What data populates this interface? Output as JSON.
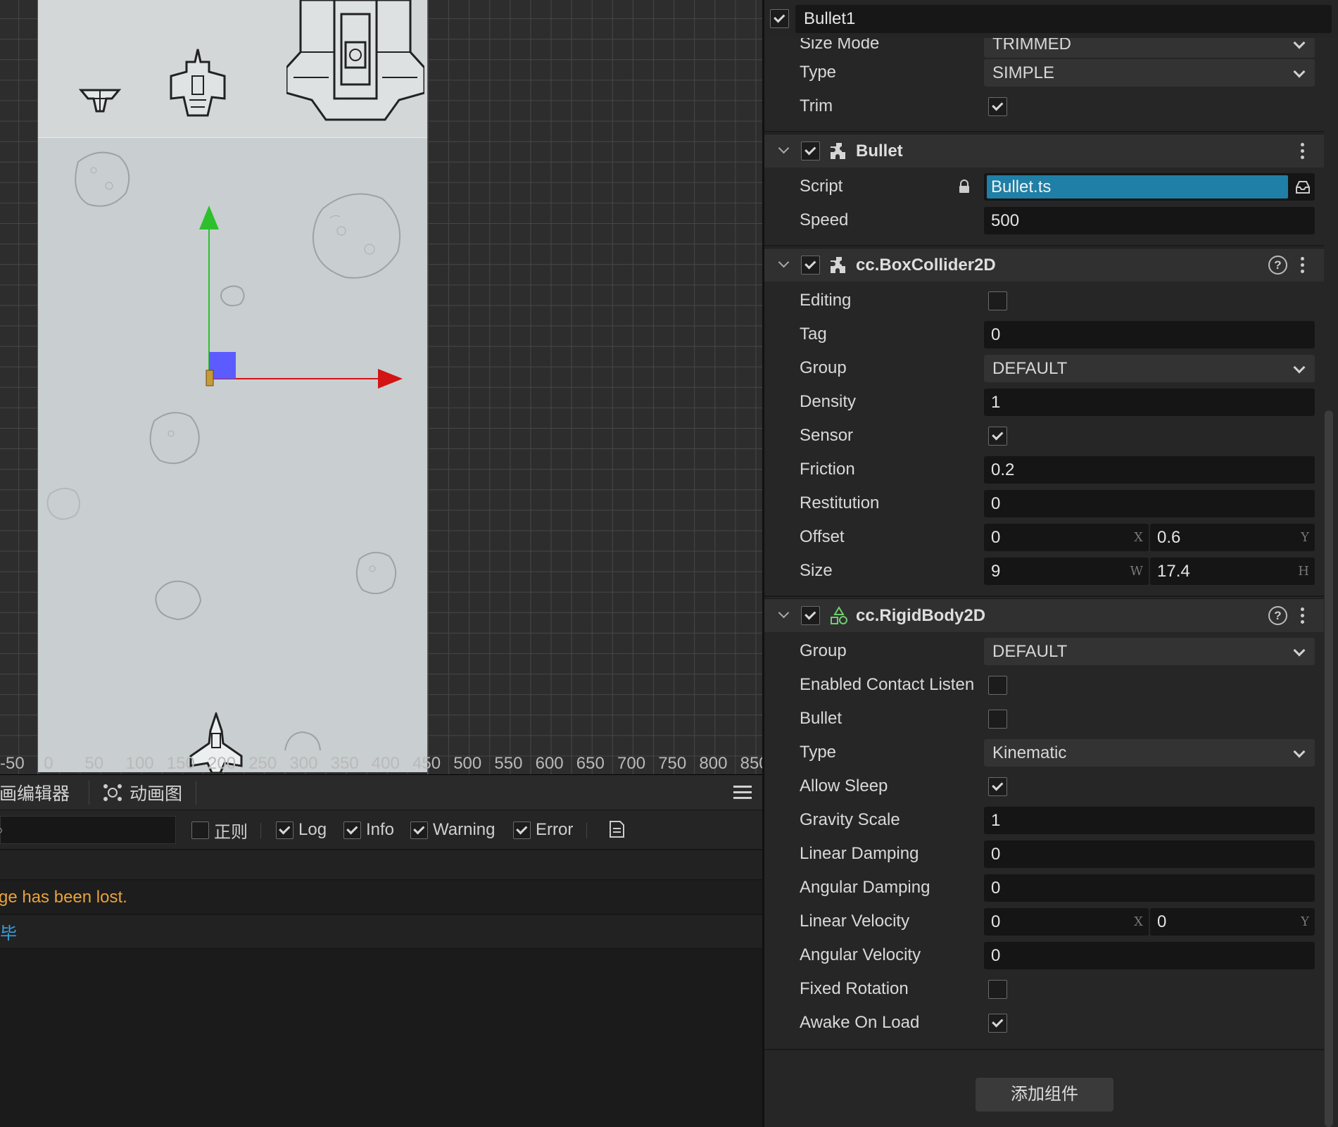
{
  "scene": {
    "ruler_labels": [
      "-50",
      "0",
      "50",
      "100",
      "150",
      "200",
      "250",
      "300",
      "350",
      "400",
      "450",
      "500",
      "550",
      "600",
      "650",
      "700",
      "750",
      "800",
      "850"
    ]
  },
  "console": {
    "tabs": [
      {
        "label": "动画编辑器",
        "icon": "animation-editor-icon"
      },
      {
        "label": "动画图",
        "icon": "animation-graph-icon"
      }
    ],
    "filter_value": "",
    "filters": [
      {
        "label": "正则",
        "checked": false
      },
      {
        "label": "Log",
        "checked": true
      },
      {
        "label": "Info",
        "checked": true
      },
      {
        "label": "Warning",
        "checked": true
      },
      {
        "label": "Error",
        "checked": true
      }
    ],
    "messages": [
      {
        "text": "ge has been lost.",
        "color": "#e8a33b"
      },
      {
        "text": "毕",
        "color": "#3aa0e0"
      }
    ],
    "colors": {
      "warning": "#e8a33b",
      "info": "#3aa0e0"
    }
  },
  "inspector": {
    "node_name": "Bullet1",
    "node_enabled": true,
    "sprite": {
      "size_mode_label": "Size Mode",
      "size_mode_value": "TRIMMED",
      "type_label": "Type",
      "type_value": "SIMPLE",
      "trim_label": "Trim",
      "trim": true
    },
    "bullet": {
      "title": "Bullet",
      "script_label": "Script",
      "script_value": "Bullet.ts",
      "speed_label": "Speed",
      "speed_value": "500"
    },
    "box_collider": {
      "title": "cc.BoxCollider2D",
      "editing_label": "Editing",
      "editing": false,
      "tag_label": "Tag",
      "tag_value": "0",
      "group_label": "Group",
      "group_value": "DEFAULT",
      "density_label": "Density",
      "density_value": "1",
      "sensor_label": "Sensor",
      "sensor": true,
      "friction_label": "Friction",
      "friction_value": "0.2",
      "restitution_label": "Restitution",
      "restitution_value": "0",
      "offset_label": "Offset",
      "offset_x": "0",
      "offset_y": "0.6",
      "size_label": "Size",
      "size_w": "9",
      "size_h": "17.4"
    },
    "rigid_body": {
      "title": "cc.RigidBody2D",
      "group_label": "Group",
      "group_value": "DEFAULT",
      "contact_label": "Enabled Contact Listen",
      "contact": false,
      "bullet_label": "Bullet",
      "bullet": false,
      "type_label": "Type",
      "type_value": "Kinematic",
      "allow_sleep_label": "Allow Sleep",
      "allow_sleep": true,
      "gravity_label": "Gravity Scale",
      "gravity_value": "1",
      "linear_damping_label": "Linear Damping",
      "linear_damping_value": "0",
      "angular_damping_label": "Angular Damping",
      "angular_damping_value": "0",
      "linear_velocity_label": "Linear Velocity",
      "linear_velocity_x": "0",
      "linear_velocity_y": "0",
      "angular_velocity_label": "Angular Velocity",
      "angular_velocity_value": "0",
      "fixed_rotation_label": "Fixed Rotation",
      "fixed_rotation": false,
      "awake_label": "Awake On Load",
      "awake": true
    },
    "axis_labels": {
      "x": "X",
      "y": "Y",
      "w": "W",
      "h": "H"
    },
    "add_component_label": "添加组件",
    "colors": {
      "script_field": "#1f7fa6",
      "gizmo_x": "#d21414",
      "gizmo_y": "#2cc12c",
      "gizmo_center": "#5b5bff"
    }
  }
}
